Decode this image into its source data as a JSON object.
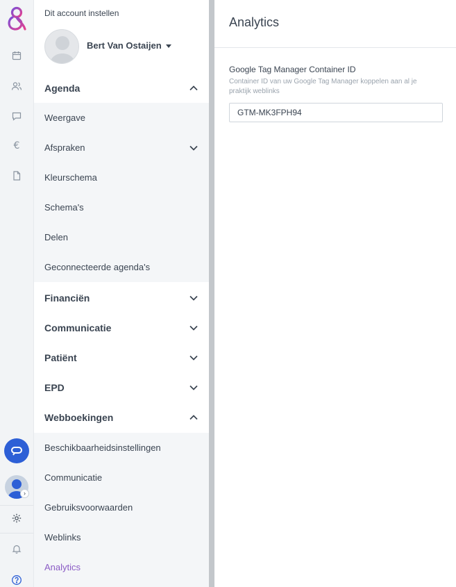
{
  "colors": {
    "accent": "#8b5cc5",
    "logo_pink": "#e4418f",
    "logo_purple": "#7b4fd6",
    "chat_button": "#2d5fd6",
    "text": "#3a4451",
    "muted": "#9aa3ad"
  },
  "rail": {
    "icons": [
      "logo-icon",
      "calendar-icon",
      "people-icon",
      "chat-icon",
      "euro-icon",
      "document-icon",
      "support-chat-icon",
      "user-avatar",
      "gear-icon",
      "bell-icon",
      "help-icon"
    ],
    "euro_glyph": "€"
  },
  "sidebar": {
    "heading": "Dit account instellen",
    "user_name": "Bert Van Ostaijen",
    "sections": [
      {
        "label": "Agenda",
        "expanded": true,
        "items": [
          {
            "label": "Weergave"
          },
          {
            "label": "Afspraken",
            "has_children": true
          },
          {
            "label": "Kleurschema"
          },
          {
            "label": "Schema's"
          },
          {
            "label": "Delen"
          },
          {
            "label": "Geconnecteerde agenda's"
          }
        ]
      },
      {
        "label": "Financiën",
        "expanded": false
      },
      {
        "label": "Communicatie",
        "expanded": false
      },
      {
        "label": "Patiënt",
        "expanded": false
      },
      {
        "label": "EPD",
        "expanded": false
      },
      {
        "label": "Webboekingen",
        "expanded": true,
        "items": [
          {
            "label": "Beschikbaarheidsinstellingen"
          },
          {
            "label": "Communicatie"
          },
          {
            "label": "Gebruiksvoorwaarden"
          },
          {
            "label": "Weblinks"
          },
          {
            "label": "Analytics",
            "active": true
          }
        ]
      }
    ]
  },
  "main": {
    "title": "Analytics",
    "field": {
      "label": "Google Tag Manager Container ID",
      "help": "Container ID van uw Google Tag Manager koppelen aan al je praktijk weblinks",
      "value": "GTM-MK3FPH94"
    }
  }
}
